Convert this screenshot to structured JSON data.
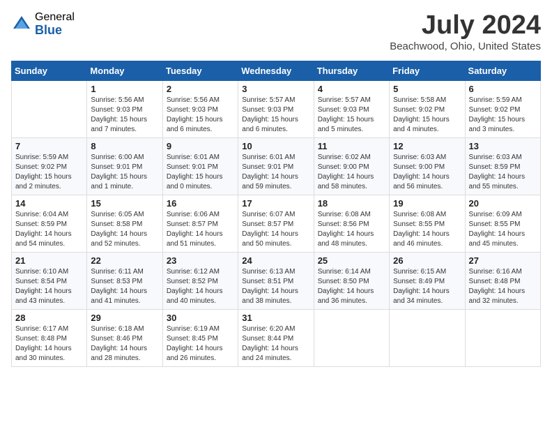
{
  "logo": {
    "general": "General",
    "blue": "Blue"
  },
  "title": "July 2024",
  "location": "Beachwood, Ohio, United States",
  "days_of_week": [
    "Sunday",
    "Monday",
    "Tuesday",
    "Wednesday",
    "Thursday",
    "Friday",
    "Saturday"
  ],
  "weeks": [
    [
      {
        "day": "",
        "sunrise": "",
        "sunset": "",
        "daylight": ""
      },
      {
        "day": "1",
        "sunrise": "Sunrise: 5:56 AM",
        "sunset": "Sunset: 9:03 PM",
        "daylight": "Daylight: 15 hours and 7 minutes."
      },
      {
        "day": "2",
        "sunrise": "Sunrise: 5:56 AM",
        "sunset": "Sunset: 9:03 PM",
        "daylight": "Daylight: 15 hours and 6 minutes."
      },
      {
        "day": "3",
        "sunrise": "Sunrise: 5:57 AM",
        "sunset": "Sunset: 9:03 PM",
        "daylight": "Daylight: 15 hours and 6 minutes."
      },
      {
        "day": "4",
        "sunrise": "Sunrise: 5:57 AM",
        "sunset": "Sunset: 9:03 PM",
        "daylight": "Daylight: 15 hours and 5 minutes."
      },
      {
        "day": "5",
        "sunrise": "Sunrise: 5:58 AM",
        "sunset": "Sunset: 9:02 PM",
        "daylight": "Daylight: 15 hours and 4 minutes."
      },
      {
        "day": "6",
        "sunrise": "Sunrise: 5:59 AM",
        "sunset": "Sunset: 9:02 PM",
        "daylight": "Daylight: 15 hours and 3 minutes."
      }
    ],
    [
      {
        "day": "7",
        "sunrise": "Sunrise: 5:59 AM",
        "sunset": "Sunset: 9:02 PM",
        "daylight": "Daylight: 15 hours and 2 minutes."
      },
      {
        "day": "8",
        "sunrise": "Sunrise: 6:00 AM",
        "sunset": "Sunset: 9:01 PM",
        "daylight": "Daylight: 15 hours and 1 minute."
      },
      {
        "day": "9",
        "sunrise": "Sunrise: 6:01 AM",
        "sunset": "Sunset: 9:01 PM",
        "daylight": "Daylight: 15 hours and 0 minutes."
      },
      {
        "day": "10",
        "sunrise": "Sunrise: 6:01 AM",
        "sunset": "Sunset: 9:01 PM",
        "daylight": "Daylight: 14 hours and 59 minutes."
      },
      {
        "day": "11",
        "sunrise": "Sunrise: 6:02 AM",
        "sunset": "Sunset: 9:00 PM",
        "daylight": "Daylight: 14 hours and 58 minutes."
      },
      {
        "day": "12",
        "sunrise": "Sunrise: 6:03 AM",
        "sunset": "Sunset: 9:00 PM",
        "daylight": "Daylight: 14 hours and 56 minutes."
      },
      {
        "day": "13",
        "sunrise": "Sunrise: 6:03 AM",
        "sunset": "Sunset: 8:59 PM",
        "daylight": "Daylight: 14 hours and 55 minutes."
      }
    ],
    [
      {
        "day": "14",
        "sunrise": "Sunrise: 6:04 AM",
        "sunset": "Sunset: 8:59 PM",
        "daylight": "Daylight: 14 hours and 54 minutes."
      },
      {
        "day": "15",
        "sunrise": "Sunrise: 6:05 AM",
        "sunset": "Sunset: 8:58 PM",
        "daylight": "Daylight: 14 hours and 52 minutes."
      },
      {
        "day": "16",
        "sunrise": "Sunrise: 6:06 AM",
        "sunset": "Sunset: 8:57 PM",
        "daylight": "Daylight: 14 hours and 51 minutes."
      },
      {
        "day": "17",
        "sunrise": "Sunrise: 6:07 AM",
        "sunset": "Sunset: 8:57 PM",
        "daylight": "Daylight: 14 hours and 50 minutes."
      },
      {
        "day": "18",
        "sunrise": "Sunrise: 6:08 AM",
        "sunset": "Sunset: 8:56 PM",
        "daylight": "Daylight: 14 hours and 48 minutes."
      },
      {
        "day": "19",
        "sunrise": "Sunrise: 6:08 AM",
        "sunset": "Sunset: 8:55 PM",
        "daylight": "Daylight: 14 hours and 46 minutes."
      },
      {
        "day": "20",
        "sunrise": "Sunrise: 6:09 AM",
        "sunset": "Sunset: 8:55 PM",
        "daylight": "Daylight: 14 hours and 45 minutes."
      }
    ],
    [
      {
        "day": "21",
        "sunrise": "Sunrise: 6:10 AM",
        "sunset": "Sunset: 8:54 PM",
        "daylight": "Daylight: 14 hours and 43 minutes."
      },
      {
        "day": "22",
        "sunrise": "Sunrise: 6:11 AM",
        "sunset": "Sunset: 8:53 PM",
        "daylight": "Daylight: 14 hours and 41 minutes."
      },
      {
        "day": "23",
        "sunrise": "Sunrise: 6:12 AM",
        "sunset": "Sunset: 8:52 PM",
        "daylight": "Daylight: 14 hours and 40 minutes."
      },
      {
        "day": "24",
        "sunrise": "Sunrise: 6:13 AM",
        "sunset": "Sunset: 8:51 PM",
        "daylight": "Daylight: 14 hours and 38 minutes."
      },
      {
        "day": "25",
        "sunrise": "Sunrise: 6:14 AM",
        "sunset": "Sunset: 8:50 PM",
        "daylight": "Daylight: 14 hours and 36 minutes."
      },
      {
        "day": "26",
        "sunrise": "Sunrise: 6:15 AM",
        "sunset": "Sunset: 8:49 PM",
        "daylight": "Daylight: 14 hours and 34 minutes."
      },
      {
        "day": "27",
        "sunrise": "Sunrise: 6:16 AM",
        "sunset": "Sunset: 8:48 PM",
        "daylight": "Daylight: 14 hours and 32 minutes."
      }
    ],
    [
      {
        "day": "28",
        "sunrise": "Sunrise: 6:17 AM",
        "sunset": "Sunset: 8:48 PM",
        "daylight": "Daylight: 14 hours and 30 minutes."
      },
      {
        "day": "29",
        "sunrise": "Sunrise: 6:18 AM",
        "sunset": "Sunset: 8:46 PM",
        "daylight": "Daylight: 14 hours and 28 minutes."
      },
      {
        "day": "30",
        "sunrise": "Sunrise: 6:19 AM",
        "sunset": "Sunset: 8:45 PM",
        "daylight": "Daylight: 14 hours and 26 minutes."
      },
      {
        "day": "31",
        "sunrise": "Sunrise: 6:20 AM",
        "sunset": "Sunset: 8:44 PM",
        "daylight": "Daylight: 14 hours and 24 minutes."
      },
      {
        "day": "",
        "sunrise": "",
        "sunset": "",
        "daylight": ""
      },
      {
        "day": "",
        "sunrise": "",
        "sunset": "",
        "daylight": ""
      },
      {
        "day": "",
        "sunrise": "",
        "sunset": "",
        "daylight": ""
      }
    ]
  ]
}
